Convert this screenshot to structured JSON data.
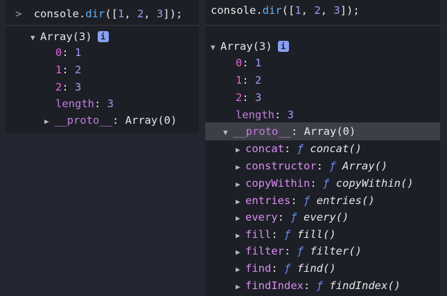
{
  "left": {
    "prompt": ">",
    "command": {
      "obj": "console.",
      "method": "dir",
      "args": "([",
      "n1": "1",
      "c1": ", ",
      "n2": "2",
      "c2": ", ",
      "n3": "3",
      "end": "]);"
    },
    "array_label": "Array(3)",
    "info_badge": "i",
    "entries": [
      {
        "key": "0",
        "value": "1"
      },
      {
        "key": "1",
        "value": "2"
      },
      {
        "key": "2",
        "value": "3"
      }
    ],
    "length_key": "length",
    "length_value": "3",
    "proto_key": "__proto__",
    "proto_value": "Array(0)"
  },
  "right": {
    "command": {
      "obj": "console.",
      "method": "dir",
      "args": "([",
      "n1": "1",
      "c1": ", ",
      "n2": "2",
      "c2": ", ",
      "n3": "3",
      "end": "]);"
    },
    "array_label": "Array(3)",
    "info_badge": "i",
    "entries": [
      {
        "key": "0",
        "value": "1"
      },
      {
        "key": "1",
        "value": "2"
      },
      {
        "key": "2",
        "value": "3"
      }
    ],
    "length_key": "length",
    "length_value": "3",
    "proto_key": "__proto__",
    "proto_value": "Array(0)",
    "methods": [
      {
        "key": "concat",
        "sig": "concat()"
      },
      {
        "key": "constructor",
        "sig": "Array()"
      },
      {
        "key": "copyWithin",
        "sig": "copyWithin()"
      },
      {
        "key": "entries",
        "sig": "entries()"
      },
      {
        "key": "every",
        "sig": "every()"
      },
      {
        "key": "fill",
        "sig": "fill()"
      },
      {
        "key": "filter",
        "sig": "filter()"
      },
      {
        "key": "find",
        "sig": "find()"
      },
      {
        "key": "findIndex",
        "sig": "findIndex()"
      }
    ],
    "f_symbol": "ƒ"
  },
  "colors": {
    "function": "#5fb3f9",
    "number": "#a39cf4",
    "key": "#d98ef0",
    "f_symbol": "#6a8cf2",
    "badge": "#8aa0f5",
    "highlight": "#3d3f47"
  },
  "icons": {
    "expanded": "triangle-down-icon",
    "collapsed": "triangle-right-icon",
    "info": "info-icon",
    "prompt": "chevron-right-icon"
  }
}
